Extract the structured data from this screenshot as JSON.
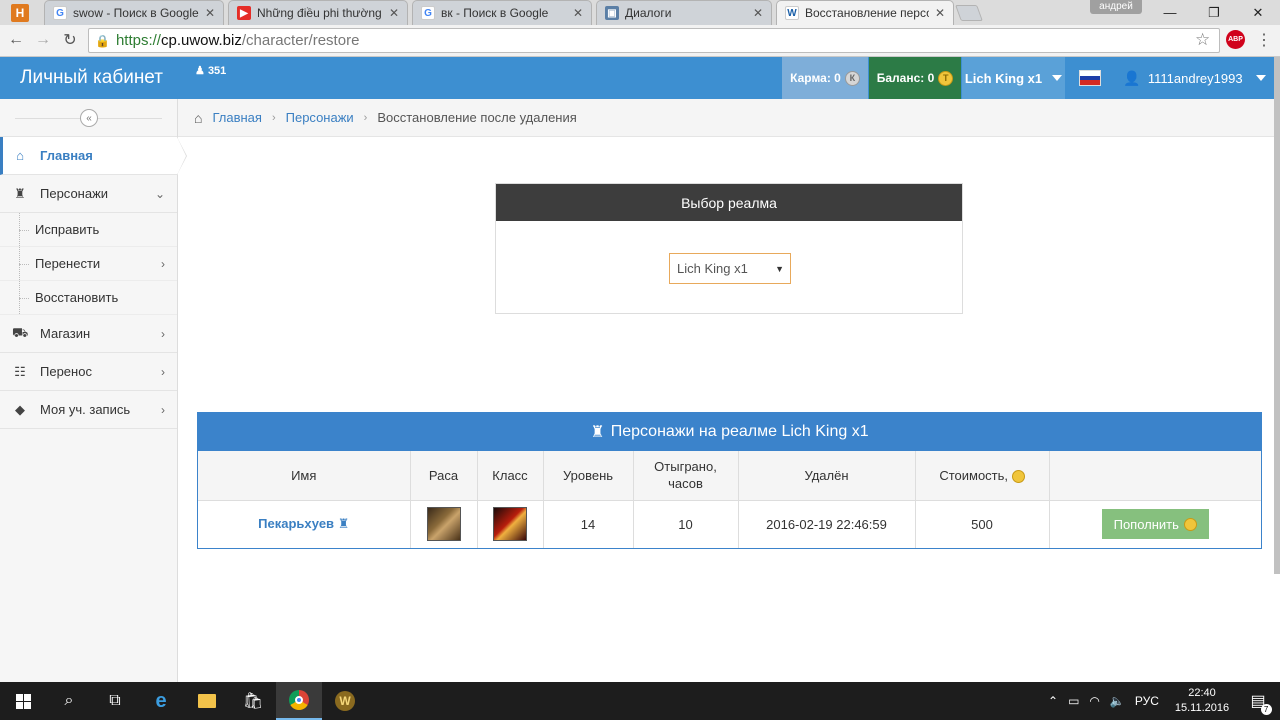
{
  "browser": {
    "tabs": [
      {
        "label": "swow - Поиск в Google",
        "icon": "google-icon",
        "color": "#4285f4",
        "glyph": "G"
      },
      {
        "label": "Những điều phi thường c",
        "icon": "youtube-icon",
        "color": "#e52d27",
        "glyph": "▶"
      },
      {
        "label": "вк - Поиск в Google",
        "icon": "google-icon",
        "color": "#4285f4",
        "glyph": "G"
      },
      {
        "label": "Диалоги",
        "icon": "vk-icon",
        "color": "#5b7fa6",
        "glyph": "▣"
      },
      {
        "label": "Восстановление персона",
        "icon": "wow-icon",
        "color": "#1a5fa8",
        "glyph": "W"
      }
    ],
    "window_user": "андрей",
    "url": {
      "scheme": "https://",
      "host": "cp.uwow.biz",
      "path": "/character/restore"
    },
    "abp_label": "ABP"
  },
  "header": {
    "brand": "Личный кабинет",
    "online": "351",
    "karma_label": "Карма: 0",
    "karma_coin": "К",
    "balance_label": "Баланс: 0",
    "balance_coin": "Т",
    "realm": "Lich King x1",
    "username": "1111andrey1993"
  },
  "sidebar": {
    "items": [
      {
        "label": "Главная",
        "icon": "home-icon",
        "glyph": "⌂"
      },
      {
        "label": "Персонажи",
        "icon": "character-icon",
        "glyph": "♜"
      },
      {
        "label": "Исправить"
      },
      {
        "label": "Перенести"
      },
      {
        "label": "Восстановить"
      },
      {
        "label": "Магазин",
        "icon": "cart-icon",
        "glyph": "🛒"
      },
      {
        "label": "Перенос",
        "icon": "signpost-icon",
        "glyph": "☷"
      },
      {
        "label": "Моя уч. запись",
        "icon": "tag-icon",
        "glyph": "◆"
      }
    ]
  },
  "breadcrumb": {
    "items": [
      "Главная",
      "Персонажи",
      "Восстановление после удаления"
    ]
  },
  "realm_widget": {
    "title": "Выбор реалма",
    "selected": "Lich King x1"
  },
  "characters": {
    "title": "Персонажи на реалме Lich King x1",
    "columns": [
      "Имя",
      "Раса",
      "Класс",
      "Уровень",
      "Отыграно, часов",
      "Удалён",
      "Стоимость,",
      ""
    ],
    "rows": [
      {
        "name": "Пекарьхуев",
        "level": "14",
        "played": "10",
        "deleted": "2016-02-19 22:46:59",
        "cost": "500",
        "action": "Пополнить"
      }
    ]
  },
  "taskbar": {
    "lang": "РУС",
    "time": "22:40",
    "date": "15.11.2016",
    "notifications": "7"
  }
}
